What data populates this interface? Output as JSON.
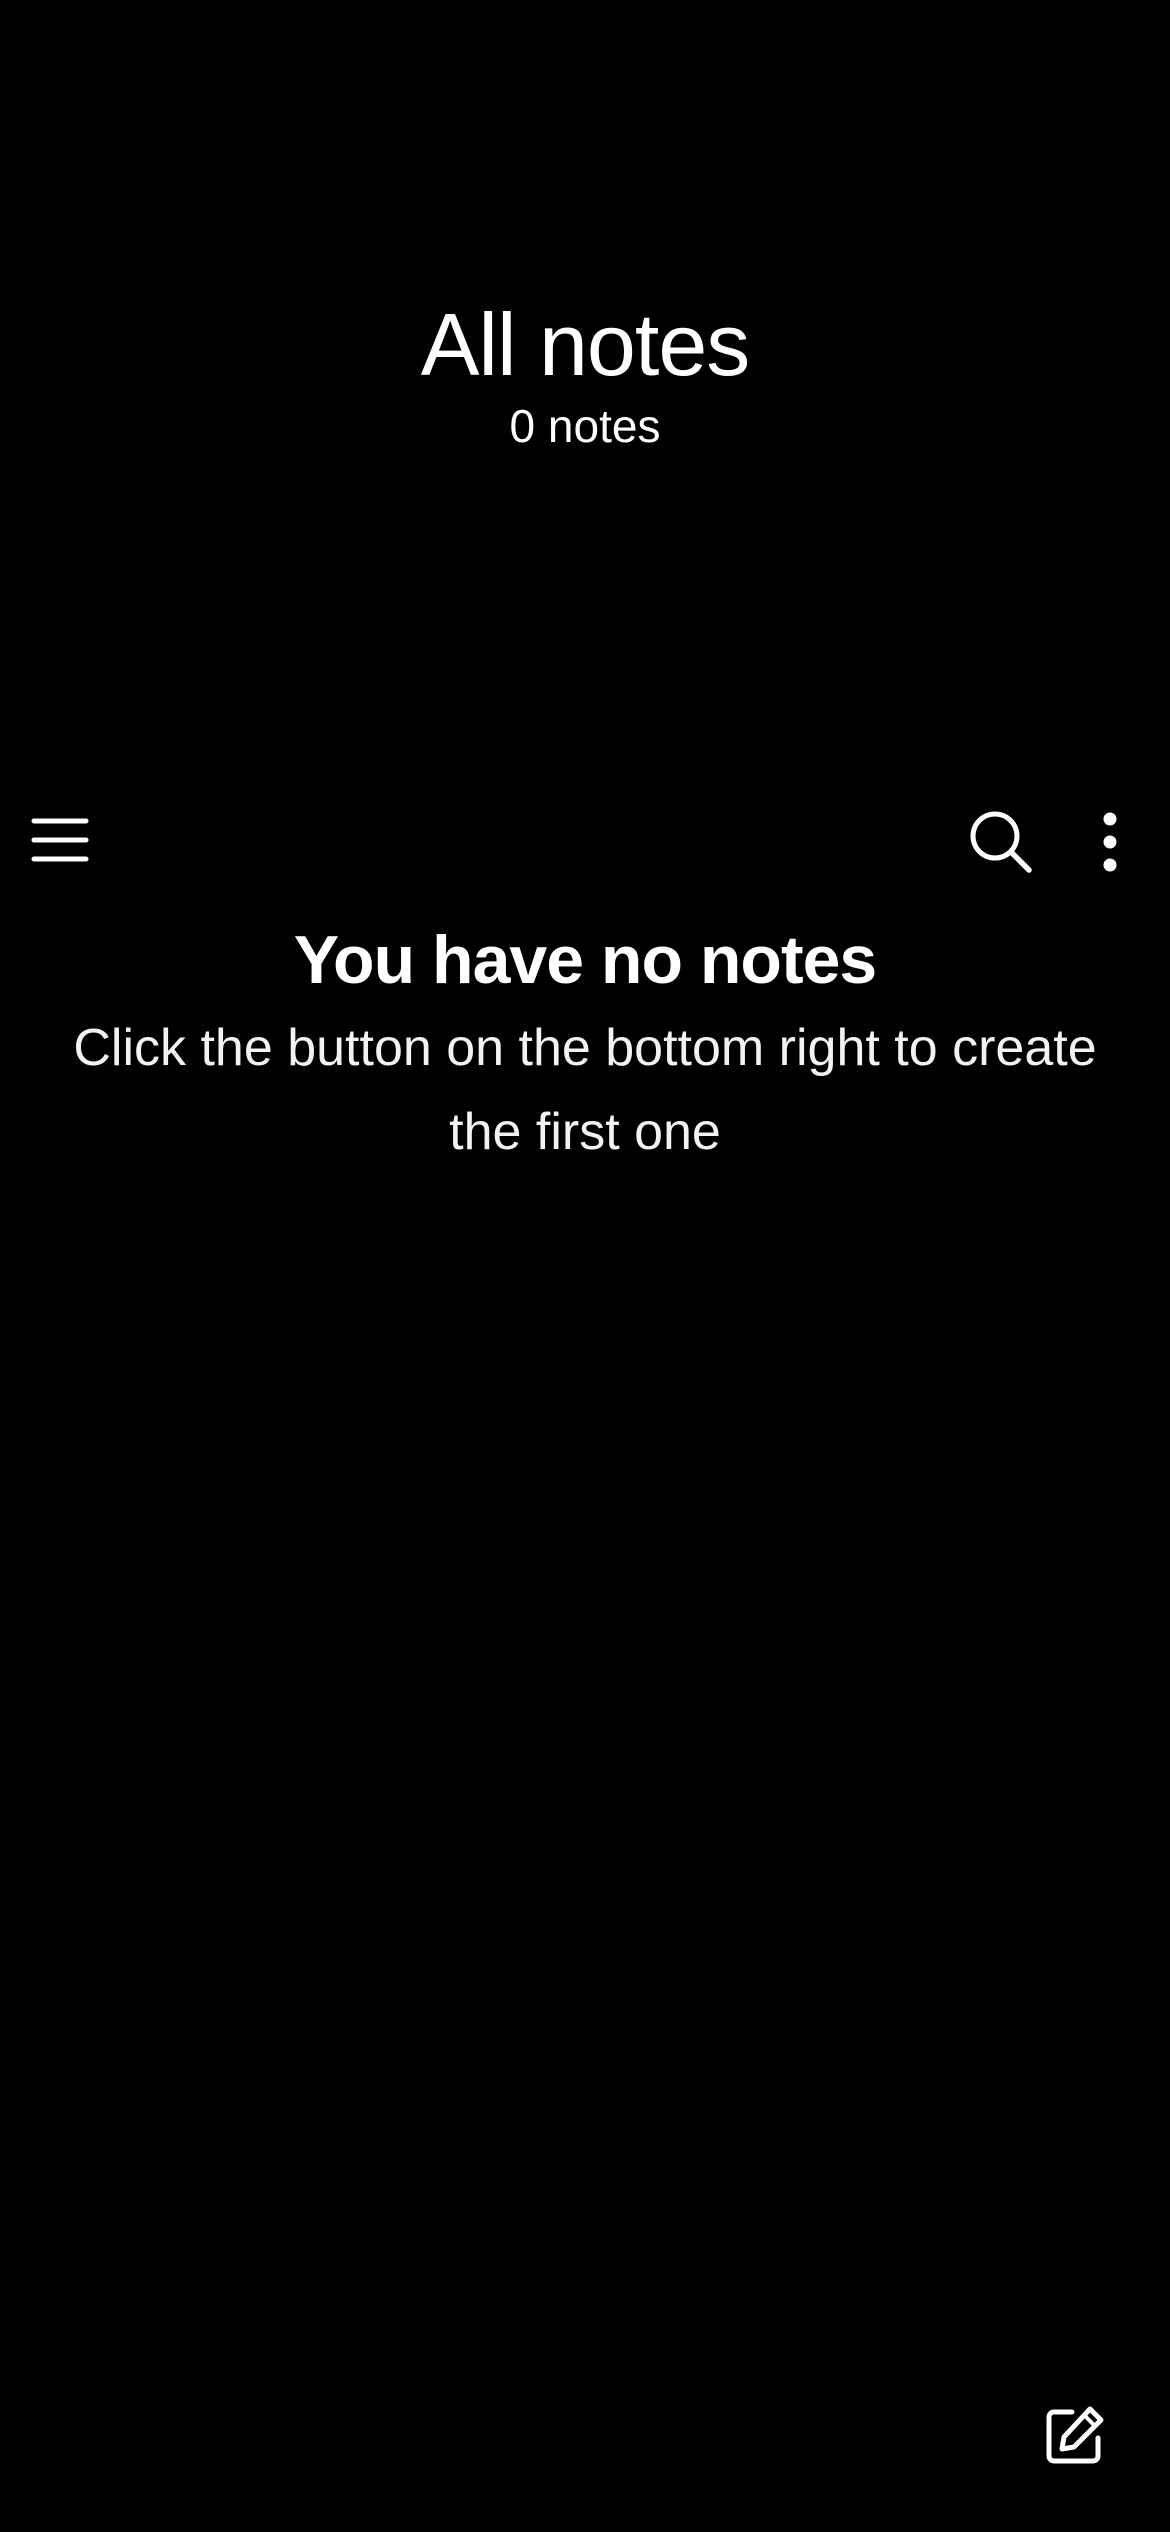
{
  "header": {
    "title": "All notes",
    "count": "0 notes"
  },
  "toolbar": {
    "menu_icon": "hamburger-menu-icon",
    "search_icon": "search-icon",
    "more_icon": "more-vertical-icon"
  },
  "empty_state": {
    "title": "You have no notes",
    "description": "Click the button on the bottom right to create the first one"
  },
  "fab": {
    "icon": "edit-note-icon"
  },
  "colors": {
    "background": "#000000",
    "foreground": "#ffffff"
  }
}
